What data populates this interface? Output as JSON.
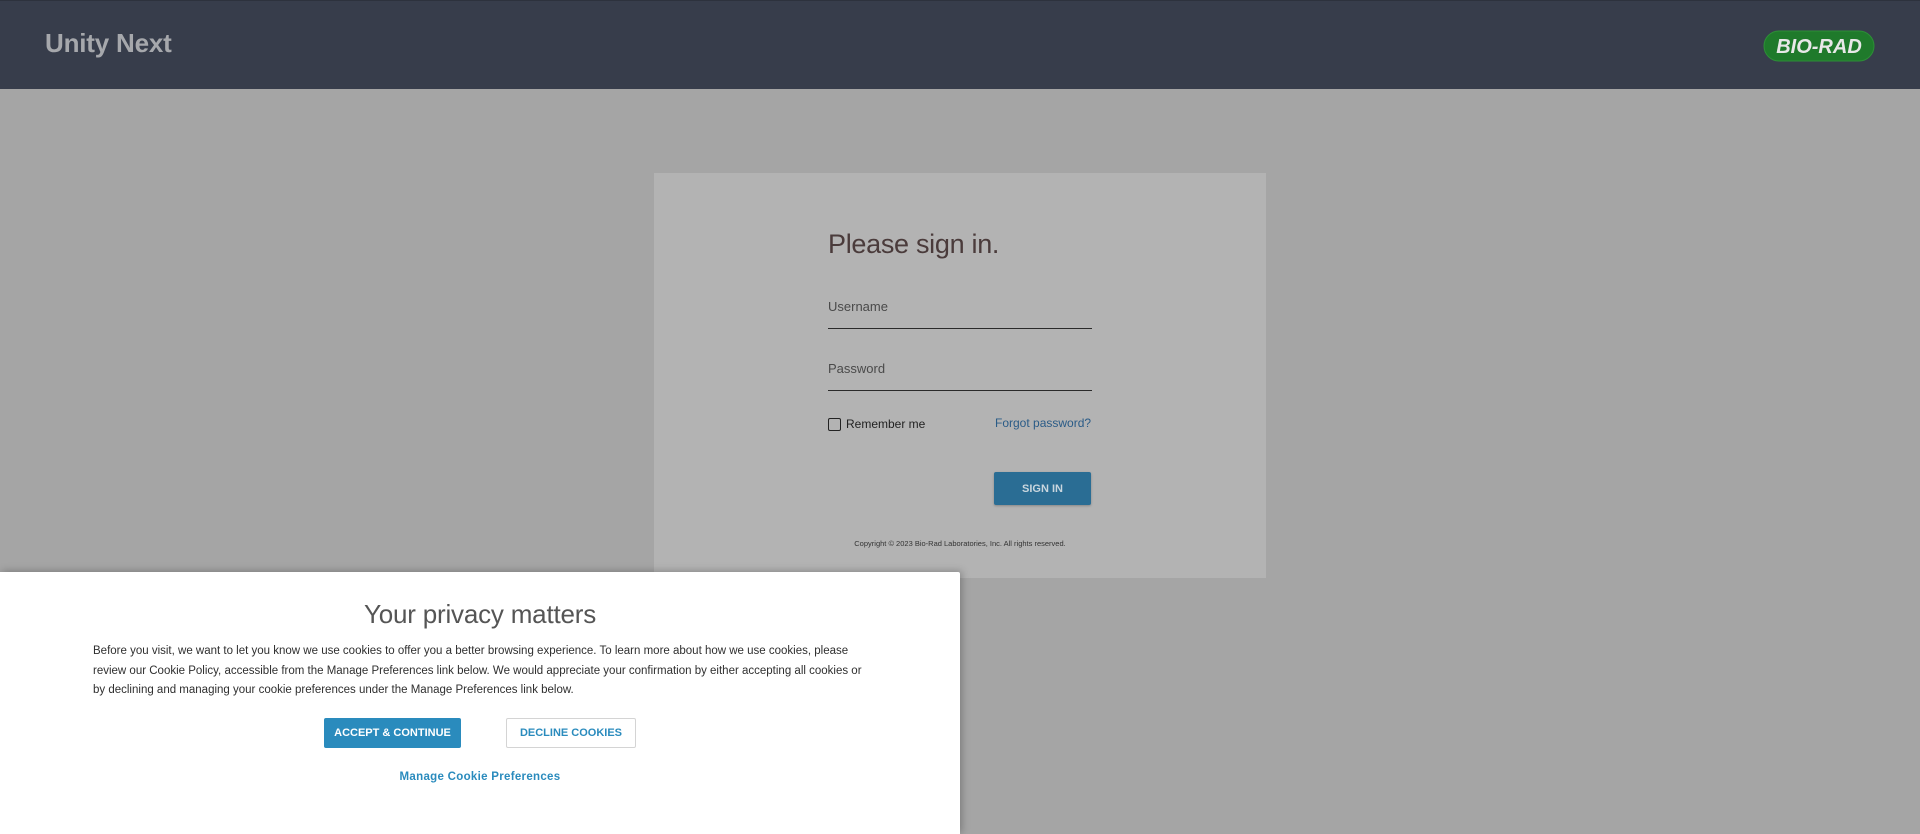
{
  "header": {
    "app_title": "Unity Next",
    "logo_text": "BIO-RAD",
    "background_color": "#373d4b",
    "logo_color": "#1f7a2b"
  },
  "login": {
    "title": "Please sign in.",
    "username_label": "Username",
    "username_value": "",
    "password_label": "Password",
    "password_value": "",
    "remember_label": "Remember me",
    "remember_checked": false,
    "forgot_label": "Forgot password?",
    "signin_label": "SIGN IN",
    "copyright": "Copyright © 2023 Bio-Rad Laboratories, Inc. All rights reserved."
  },
  "cookie": {
    "title": "Your privacy matters",
    "text": "Before you visit, we want to let you know we use cookies to offer you a better browsing experience. To learn more about how we use cookies, please review our Cookie Policy, accessible from the Manage Preferences link below. We would appreciate your confirmation by either accepting all cookies or by declining and managing your cookie preferences under the Manage Preferences link below.",
    "accept_label": "ACCEPT & CONTINUE",
    "decline_label": "DECLINE COOKIES",
    "manage_label": "Manage Cookie Preferences",
    "accent_color": "#2a8bbd"
  }
}
